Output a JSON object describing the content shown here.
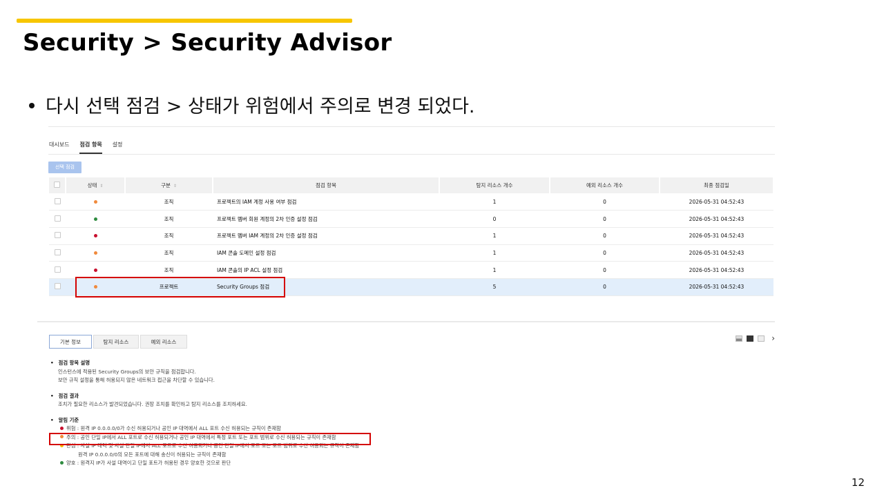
{
  "slide": {
    "title": "Security  >  Security  Advisor",
    "bullet": "다시 선택 점검 > 상태가 위험에서 주의로 변경 되었다.",
    "page_number": "12"
  },
  "colors": {
    "accent": "#f7c600",
    "danger": "#c8102e",
    "warning": "#f08a3c",
    "ok": "#2e8b3f",
    "interest": "#f5b800",
    "highlight": "#d40000"
  },
  "app": {
    "tabs": [
      {
        "label": "대시보드"
      },
      {
        "label": "점검 항목"
      },
      {
        "label": "설정"
      }
    ],
    "active_tab": "점검 항목",
    "check_button": "선택 점검",
    "table": {
      "headers": {
        "status": "상태",
        "type": "구분",
        "item": "점검 항목",
        "detected": "탐지 리소스 개수",
        "excluded": "예외 리소스 개수",
        "last_checked": "최종 점검일"
      },
      "rows": [
        {
          "status": "warning",
          "type": "조직",
          "item": "프로젝트의 IAM 계정 사용 여부 점검",
          "detected": "1",
          "excluded": "0",
          "last_checked": "2026-05-31 04:52:43"
        },
        {
          "status": "ok",
          "type": "조직",
          "item": "프로젝트 멤버 회원 계정의 2차 인증 설정 점검",
          "detected": "0",
          "excluded": "0",
          "last_checked": "2026-05-31 04:52:43"
        },
        {
          "status": "danger",
          "type": "조직",
          "item": "프로젝트 멤버 IAM 계정의 2차 인증 설정 점검",
          "detected": "1",
          "excluded": "0",
          "last_checked": "2026-05-31 04:52:43"
        },
        {
          "status": "warning",
          "type": "조직",
          "item": "IAM 콘솔 도메인 설정 점검",
          "detected": "1",
          "excluded": "0",
          "last_checked": "2026-05-31 04:52:43"
        },
        {
          "status": "danger",
          "type": "조직",
          "item": "IAM 콘솔의 IP ACL 설정 점검",
          "detected": "1",
          "excluded": "0",
          "last_checked": "2026-05-31 04:52:43"
        },
        {
          "status": "warning",
          "type": "프로젝트",
          "item": "Security Groups 점검",
          "detected": "5",
          "excluded": "0",
          "last_checked": "2026-05-31 04:52:43"
        }
      ]
    },
    "detail_tabs": [
      {
        "label": "기본 정보"
      },
      {
        "label": "탐지 리소스"
      },
      {
        "label": "예외 리소스"
      }
    ],
    "detail": {
      "desc_heading": "점검 항목 설명",
      "desc_line1": "인스턴스에 적용된 Security Groups의 보안 규칙을 점검합니다.",
      "desc_line2": "보안 규칙 설정을 통해 허용되지 않은 네트워크 접근을 차단할 수 있습니다.",
      "result_heading": "점검 결과",
      "result_text": "조치가 필요한 리소스가 발견되었습니다. 권장 조치를 확인하고 탐지 리소스를 조치하세요.",
      "criteria_heading": "알림 기준",
      "criteria_danger": "위험 : 원격 IP 0.0.0.0/0가 수신 허용되거나 공인 IP 대역에서 ALL 포트 수신 허용되는 규칙이 존재함",
      "criteria_warning": "주의 : 공인 단일 IP에서 ALL 포트로 수신 허용되거나 공인 IP 대역에서 특정 포트 또는 포트 범위로 수신 허용되는 규칙이 존재함",
      "criteria_interest": "관심 : 사설 IP 대역 및 사설 단일 IP에서 ALL 포트로 수신 허용되거나 공인 단일 IP에서 포트 또는 포트 범위로 수신 허용되는 규칙이 존재함",
      "criteria_interest2": "원격 IP 0.0.0.0/0의 모든 포트에 대해 송신이 허용되는 규칙이 존재함",
      "criteria_good": "양호 : 원격지 IP가 사설 대역이고 단일 포트가 허용된 경우 양호한 것으로 판단"
    }
  }
}
